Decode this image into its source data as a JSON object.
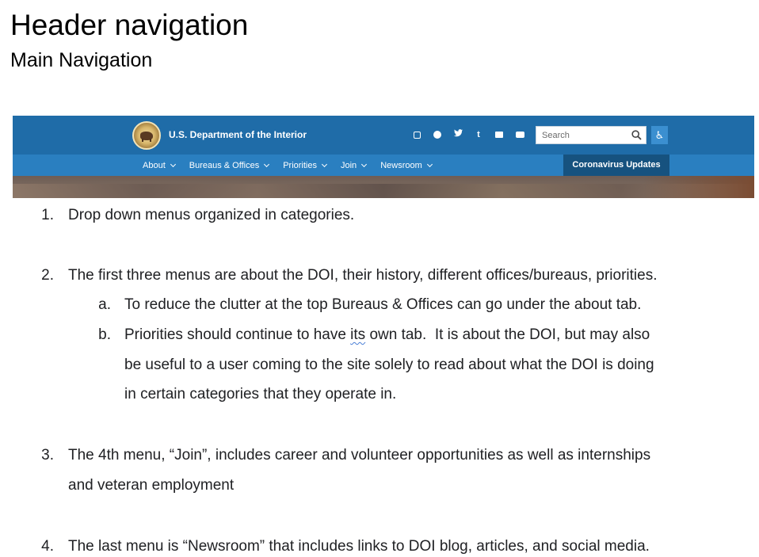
{
  "document": {
    "title": "Header navigation",
    "subtitle": "Main Navigation"
  },
  "screenshot": {
    "brand": "U.S. Department of the Interior",
    "social_icons": [
      "instagram-icon",
      "facebook-icon",
      "twitter-icon",
      "tumblr-icon",
      "flickr-icon",
      "youtube-icon"
    ],
    "search_placeholder": "Search",
    "accessibility_glyph": "♿",
    "nav": [
      {
        "label": "About"
      },
      {
        "label": "Bureaus & Offices"
      },
      {
        "label": "Priorities"
      },
      {
        "label": "Join"
      },
      {
        "label": "Newsroom"
      }
    ],
    "covid_label": "Coronavirus Updates",
    "colors": {
      "top_bar": "#1f6ca8",
      "nav_bar": "#2a7fc0",
      "covid_bg": "#16527f"
    }
  },
  "list": {
    "item1": {
      "num": "1.",
      "text": "Drop down menus organized in categories."
    },
    "item2": {
      "num": "2.",
      "text": "The first three menus are about the DOI, their history, different offices/bureaus, priorities."
    },
    "item2a": {
      "num": "a.",
      "text": "To reduce the clutter at the top Bureaus & Offices can go under the about tab."
    },
    "item2b": {
      "num": "b.",
      "line1_pre": "Priorities should continue to have ",
      "line1_flag": "its",
      "line1_post": " own tab.  It is about the DOI, but may also",
      "line2": "be useful to a user coming to the site solely to read about what the DOI is doing",
      "line3": "in certain categories that they operate in."
    },
    "item3": {
      "num": "3.",
      "line1": "The 4th menu, “Join”, includes career and volunteer opportunities as well as internships",
      "line2": "and veteran employment"
    },
    "item4": {
      "num": "4.",
      "text": "The last menu is “Newsroom” that includes links to DOI blog, articles, and social media."
    }
  }
}
